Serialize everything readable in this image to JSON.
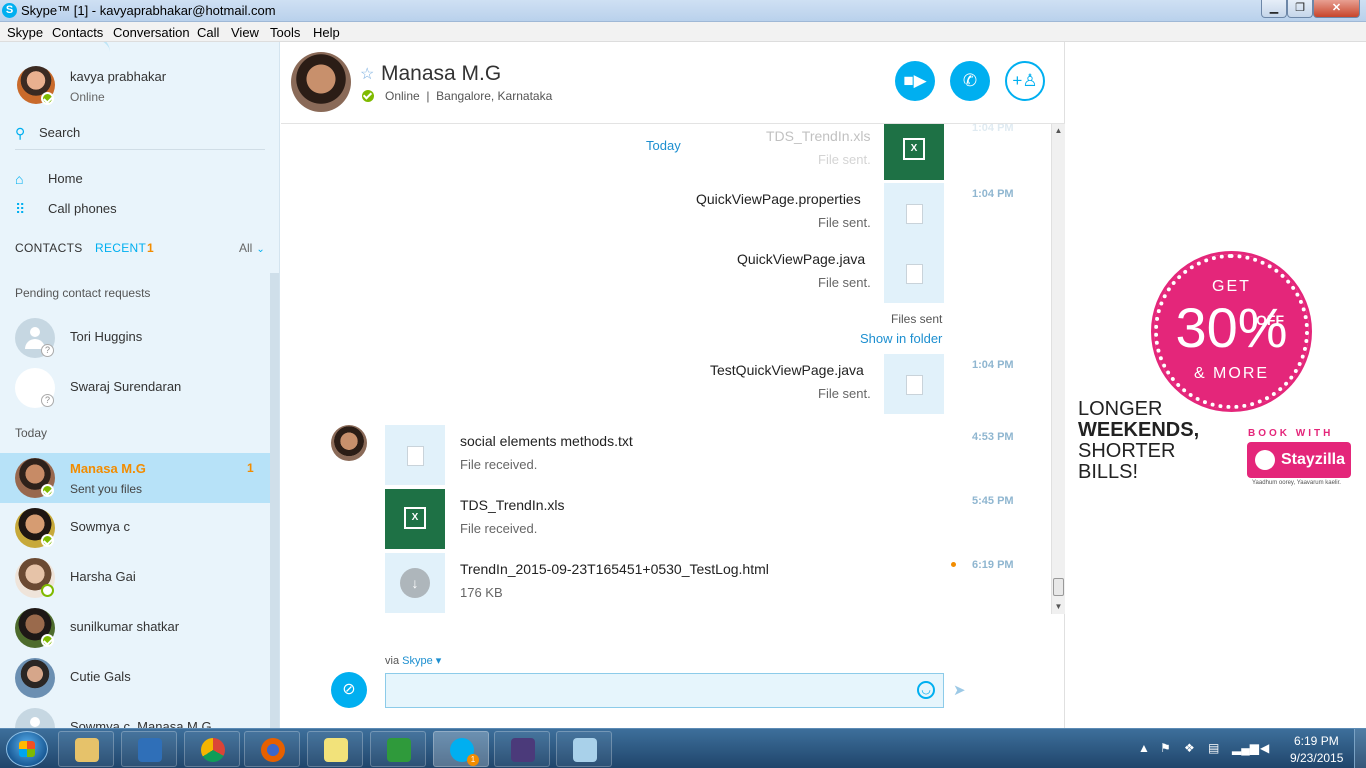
{
  "window": {
    "title": "Skype™ [1] - kavyaprabhakar@hotmail.com",
    "minimize": "▁",
    "maximize": "❐",
    "close": "✕"
  },
  "menu": [
    "Skype",
    "Contacts",
    "Conversation",
    "Call",
    "View",
    "Tools",
    "Help"
  ],
  "me": {
    "name": "kavya prabhakar",
    "status": "Online"
  },
  "sidebar": {
    "search_label": "Search",
    "nav": [
      {
        "label": "Home",
        "icon": "home-icon"
      },
      {
        "label": "Call phones",
        "icon": "dialpad-icon"
      }
    ],
    "tabs": {
      "contacts": "CONTACTS",
      "recent": "RECENT",
      "recent_count": "1",
      "filter": "All"
    },
    "pending_label": "Pending contact requests",
    "pending": [
      {
        "name": "Tori Huggins"
      },
      {
        "name": "Swaraj Surendaran"
      }
    ],
    "today_label": "Today",
    "recent": [
      {
        "name": "Manasa M.G",
        "sub": "Sent you files",
        "count": "1",
        "status": "online",
        "selected": true
      },
      {
        "name": "Sowmya c",
        "status": "online"
      },
      {
        "name": "Harsha Gai",
        "status": "away"
      },
      {
        "name": "sunilkumar shatkar",
        "status": "online"
      },
      {
        "name": "Cutie Gals",
        "status": "group"
      },
      {
        "name": "Sowmya c, Manasa M.G",
        "status": "group"
      }
    ]
  },
  "conversation": {
    "peer_name": "Manasa M.G",
    "peer_status": "Online",
    "peer_location": "Bangalore, Karnataka",
    "today_label": "Today",
    "sent_files": [
      {
        "name": "TDS_TrendIn.xls",
        "status": "File sent.",
        "time": "1:04 PM",
        "type": "excel",
        "faded": true
      },
      {
        "name": "QuickViewPage.properties",
        "status": "File sent.",
        "time": "1:04 PM",
        "type": "doc"
      },
      {
        "name": "QuickViewPage.java",
        "status": "File sent.",
        "time": "",
        "type": "doc"
      },
      {
        "name": "TestQuickViewPage.java",
        "status": "File sent.",
        "time": "1:04 PM",
        "type": "doc"
      }
    ],
    "files_sent_label": "Files sent",
    "show_in_folder": "Show in folder",
    "received_files": [
      {
        "name": "social elements methods.txt",
        "status": "File received.",
        "time": "4:53 PM",
        "type": "doc"
      },
      {
        "name": "TDS_TrendIn.xls",
        "status": "File received.",
        "time": "5:45 PM",
        "type": "excel"
      },
      {
        "name": "TrendIn_2015-09-23T165451+0530_TestLog.html",
        "status": "176 KB",
        "time": "6:19 PM",
        "type": "download"
      }
    ],
    "via_label": "via",
    "via_service": "Skype",
    "input_value": "",
    "input_placeholder": ""
  },
  "ad": {
    "get": "GET",
    "percent": "30%",
    "off": "OFF",
    "more": "& MORE",
    "headline_lines": [
      "LONGER",
      "WEEKENDS,",
      "SHORTER",
      "BILLS!"
    ],
    "book_with": "BOOK WITH",
    "brand": "Stayzilla",
    "tagline": "Yaadhum oorey, Yaavarum kaelir."
  },
  "taskbar": {
    "apps": [
      "windows-explorer",
      "media-player",
      "chrome",
      "firefox",
      "sticky-notes",
      "sublime-green",
      "skype",
      "java-ee-ide",
      "notepad-app"
    ],
    "skype_badge": "1",
    "time": "6:19 PM",
    "date": "9/23/2015"
  },
  "colors": {
    "skype_blue": "#00aff0",
    "recent_orange": "#f28c00",
    "ad_pink": "#e4267a",
    "excel_green": "#1e7145"
  }
}
